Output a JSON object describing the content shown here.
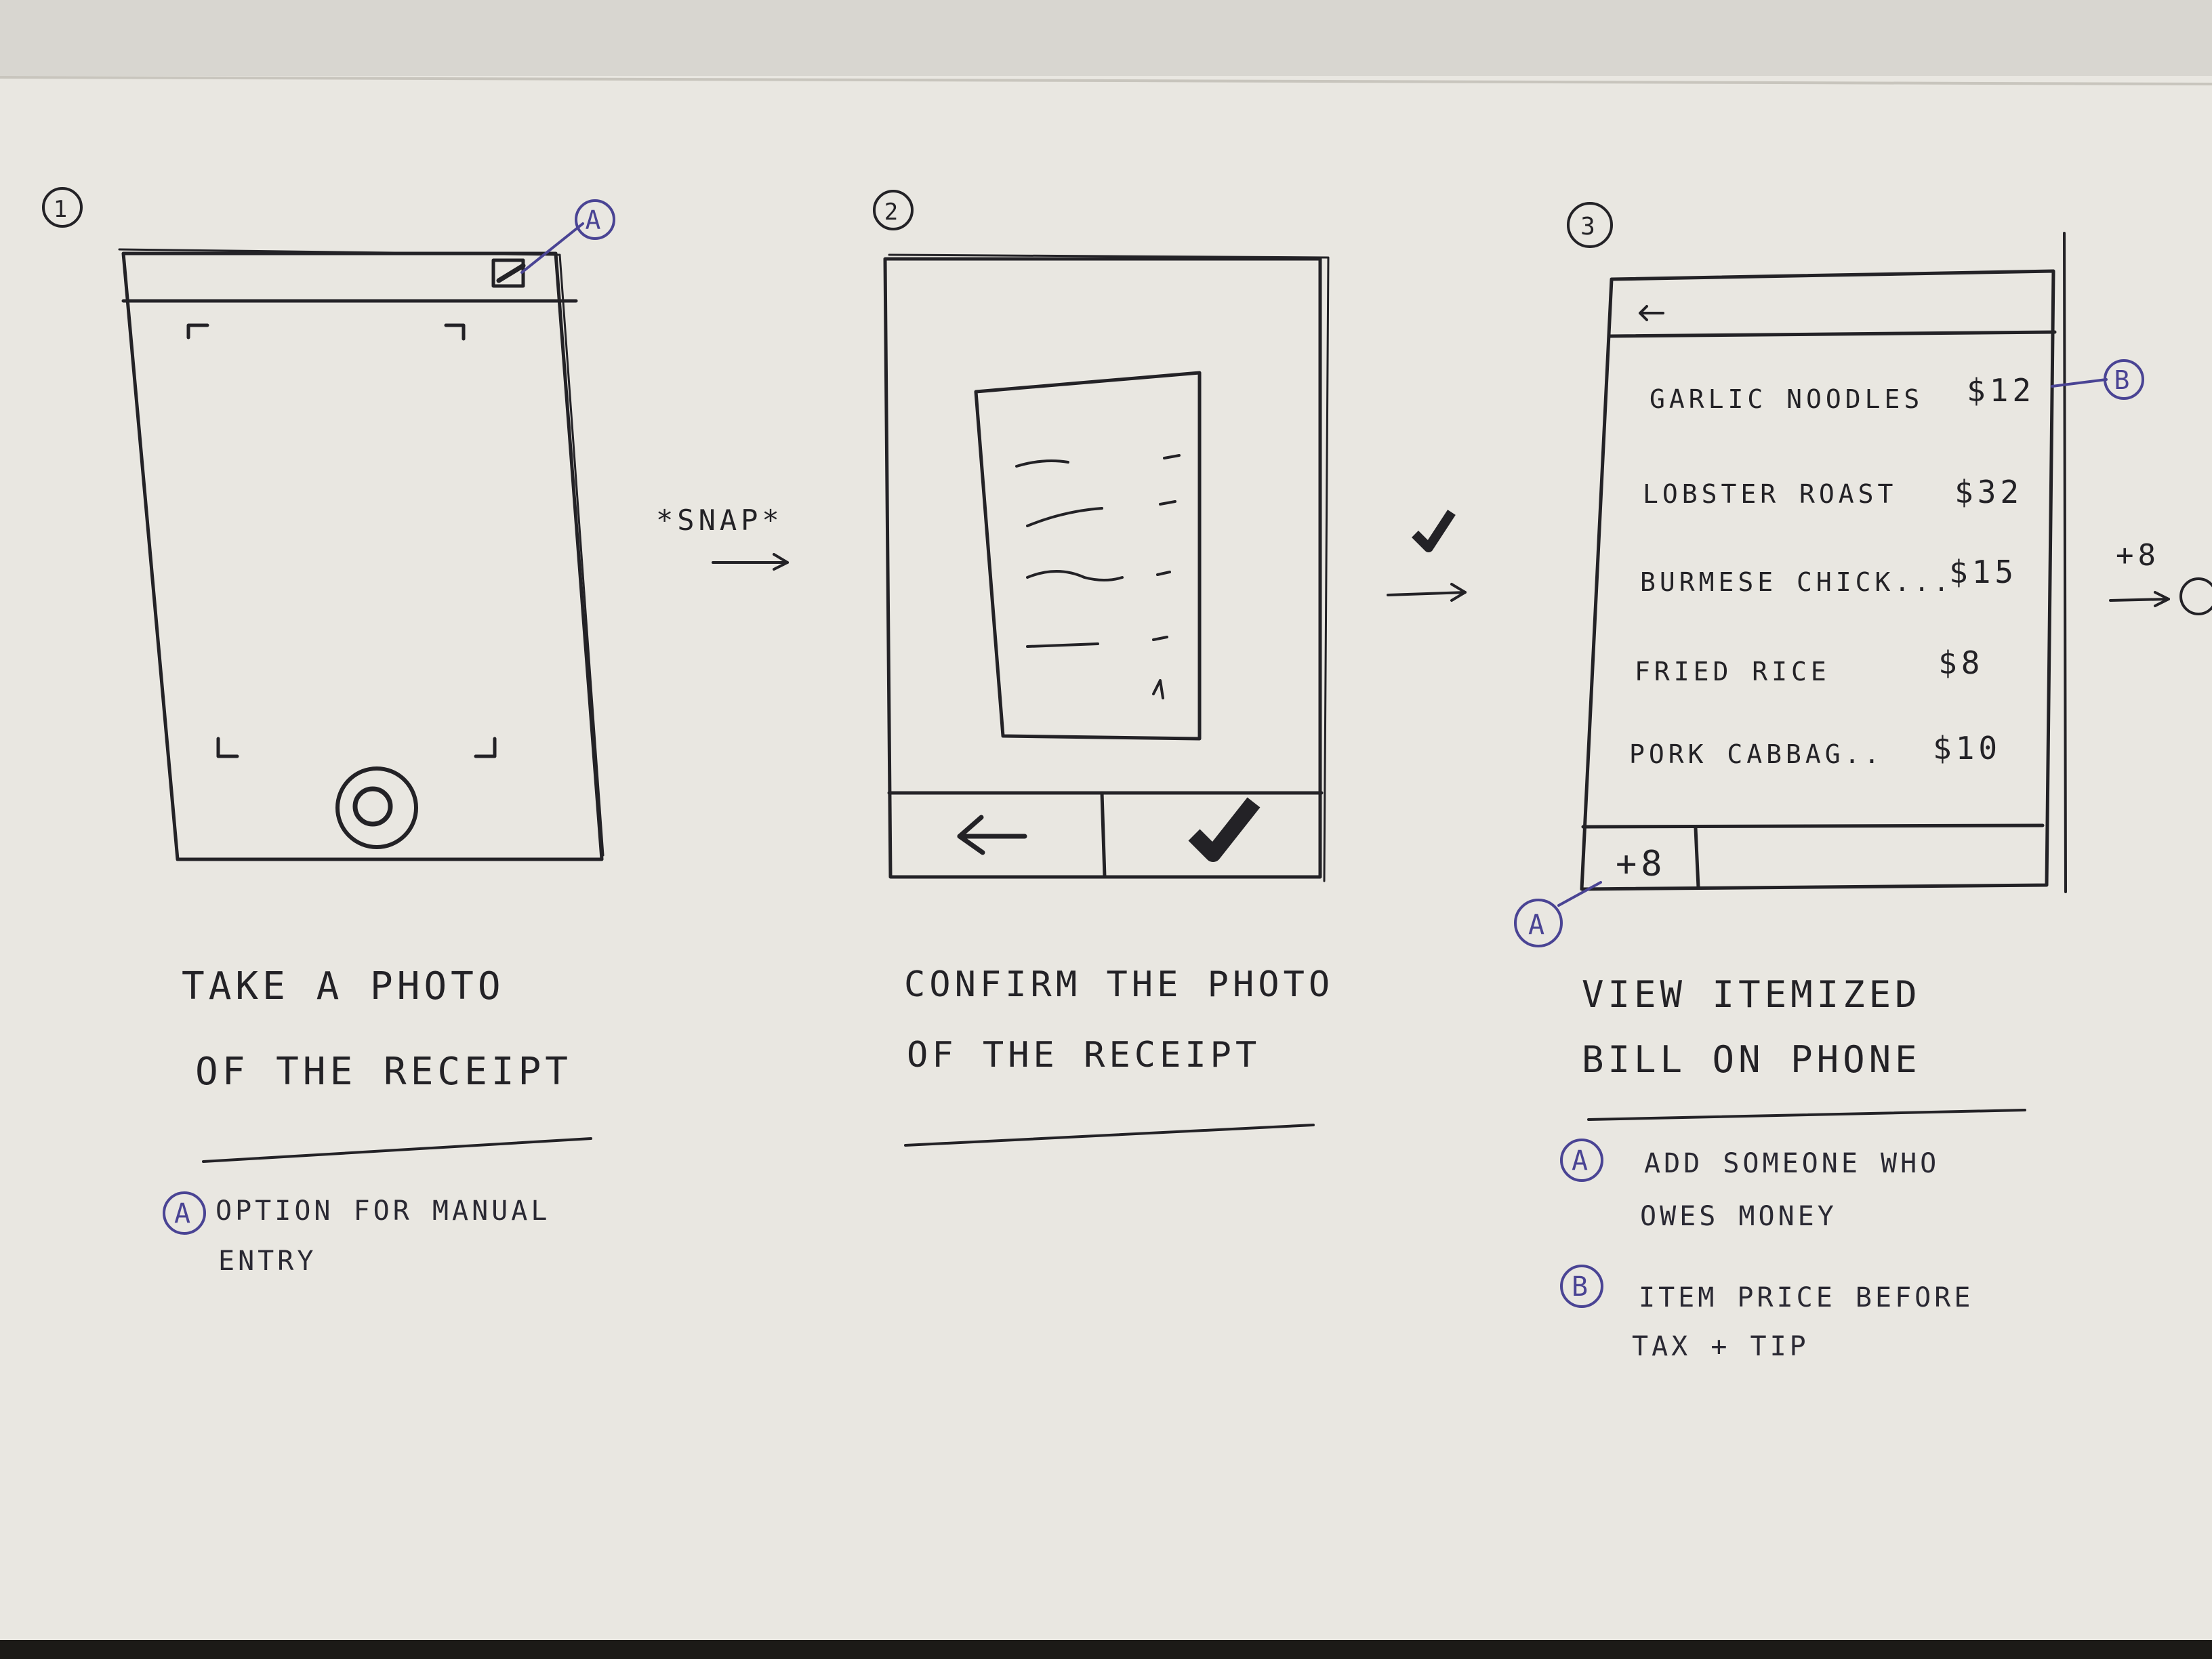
{
  "steps": [
    {
      "number": "1",
      "caption_line1": "TAKE A PHOTO",
      "caption_line2": "OF THE RECEIPT",
      "notes": [
        {
          "marker": "A",
          "line1": "OPTION FOR MANUAL",
          "line2": "ENTRY"
        }
      ],
      "callouts": [
        {
          "marker": "A"
        }
      ]
    },
    {
      "number": "2",
      "caption_line1": "CONFIRM THE PHOTO",
      "caption_line2": "OF THE RECEIPT"
    },
    {
      "number": "3",
      "caption_line1": "VIEW ITEMIZED",
      "caption_line2": "BILL ON PHONE",
      "notes": [
        {
          "marker": "A",
          "line1": "ADD SOMEONE WHO",
          "line2": "OWES MONEY"
        },
        {
          "marker": "B",
          "line1": "ITEM PRICE BEFORE",
          "line2": "TAX + TIP"
        }
      ],
      "callouts": [
        {
          "marker": "B"
        },
        {
          "marker": "A"
        }
      ],
      "add_button": "+8",
      "items": [
        {
          "name": "GARLIC NOODLES",
          "price": "$12"
        },
        {
          "name": "LOBSTER ROAST",
          "price": "$32"
        },
        {
          "name": "BURMESE CHICK...",
          "price": "$15"
        },
        {
          "name": "FRIED RICE",
          "price": "$8"
        },
        {
          "name": "PORK CABBAG..",
          "price": "$10"
        }
      ]
    }
  ],
  "transitions": [
    {
      "label": "*SNAP*"
    },
    {
      "label": "✓"
    },
    {
      "label": "+8"
    }
  ],
  "colors": {
    "paper": "#e9e7e1",
    "ink": "#232226",
    "blue_ink": "#4a4494"
  }
}
